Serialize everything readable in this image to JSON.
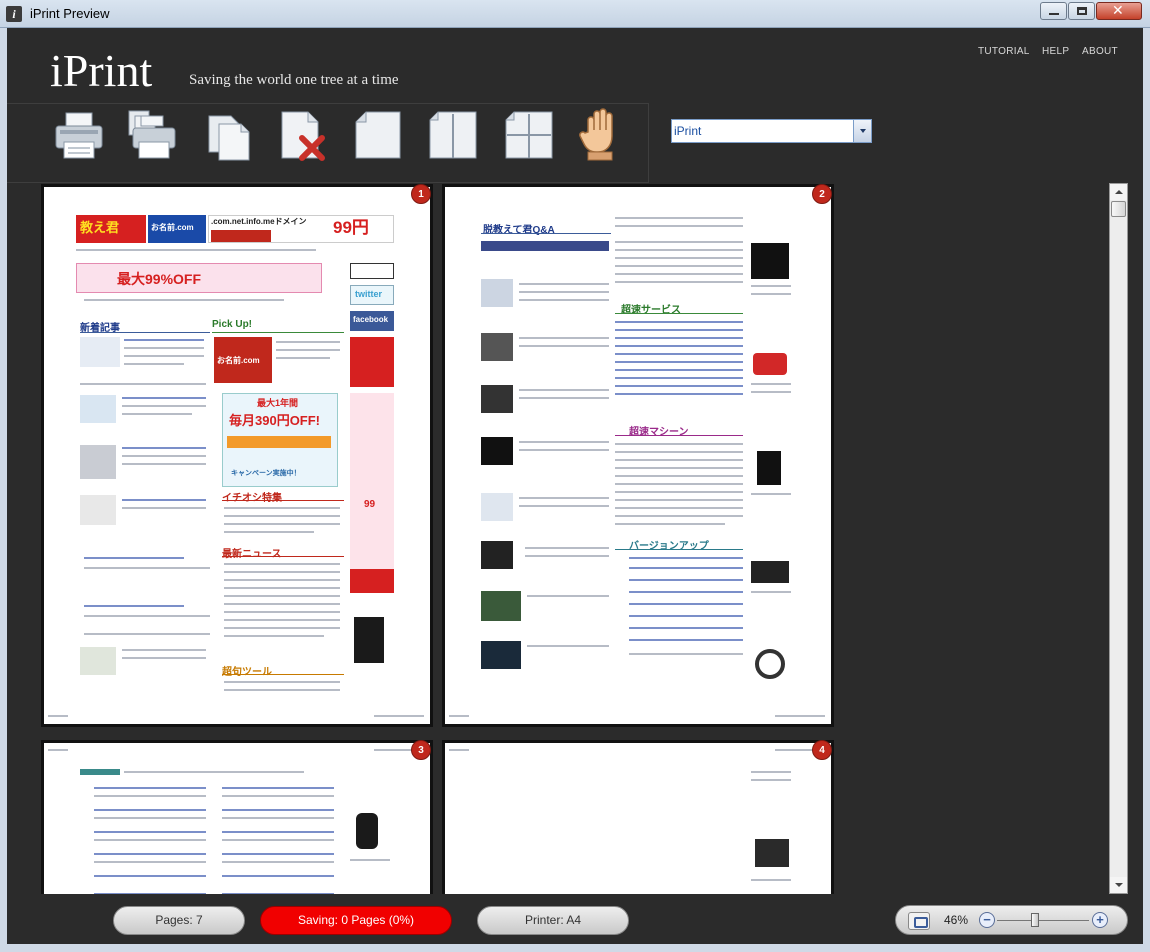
{
  "window": {
    "title": "iPrint Preview"
  },
  "header": {
    "logo": "iPrint",
    "tagline": "Saving the world one tree at a time"
  },
  "nav": {
    "tutorial": "TUTORIAL",
    "help": "HELP",
    "about": "ABOUT"
  },
  "toolbar": {
    "tools": [
      {
        "name": "print-icon"
      },
      {
        "name": "print-multiple-icon"
      },
      {
        "name": "copy-pages-icon"
      },
      {
        "name": "delete-page-icon"
      },
      {
        "name": "single-page-layout-icon"
      },
      {
        "name": "two-page-layout-icon"
      },
      {
        "name": "four-page-layout-icon"
      },
      {
        "name": "hand-pan-icon"
      }
    ]
  },
  "printer_select": {
    "value": "iPrint"
  },
  "pages": [
    {
      "number": "1"
    },
    {
      "number": "2"
    },
    {
      "number": "3"
    },
    {
      "number": "4"
    }
  ],
  "page1": {
    "banner_a": "教え君",
    "banner_b": "お名前.com",
    "banner_c": ".com.net.info.meドメイン",
    "banner_price": "99円",
    "promo": "最大99%OFF",
    "sec_new": "新着記事",
    "sec_pick": "Pick Up!",
    "pick_banner": "お名前.com",
    "ad_title": "最大1年間",
    "ad_main": "毎月390円OFF!",
    "ad_sub": "キャンペーン実施中！",
    "sec_feature": "イチオシ特集",
    "sec_news": "最新ニュース",
    "sec_tools": "超句ツール",
    "side_twitter": "twitter",
    "side_facebook": "facebook",
    "side_99": "99"
  },
  "page2": {
    "sec_qa": "脱教えて君Q&A",
    "sec_service": "超速サービス",
    "sec_machine": "超速マシーン",
    "sec_version": "バージョンアップ"
  },
  "status": {
    "pages": "Pages: 7",
    "saving": "Saving: 0 Pages (0%)",
    "printer": "Printer: A4",
    "zoom": "46%"
  },
  "colors": {
    "accent_red": "#f10000",
    "badge_red": "#c0281c",
    "background": "#2b2b2b"
  }
}
